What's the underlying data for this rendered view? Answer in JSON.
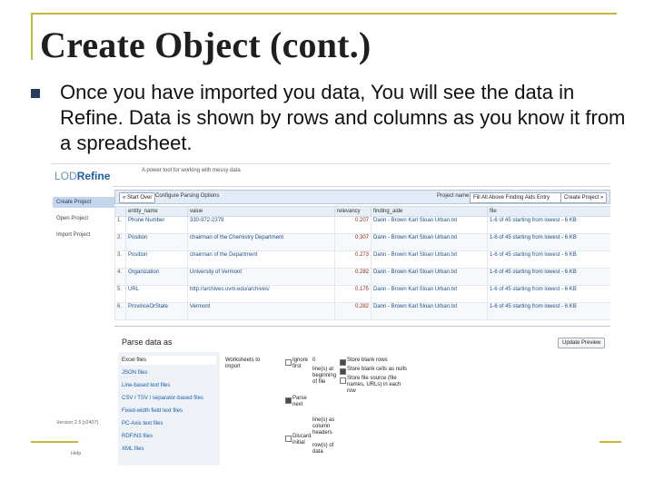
{
  "slide": {
    "title": "Create Object (cont.)",
    "bullet": "Once you have imported you data, You will see the data in Refine. Data is shown by rows and columns as you know it from a spreadsheet."
  },
  "app": {
    "logo_prefix": "LOD",
    "logo_name": "Refine",
    "tagline": "A power tool for working with messy data",
    "sidebar": {
      "items": [
        "Create Project",
        "Open Project",
        "Import Project"
      ],
      "version": "Version 2.5 [r2407]",
      "help": "Help"
    },
    "toolbar": {
      "start_over": "« Start Over",
      "configure": "Configure Parsing Options",
      "project_name_label": "Project name",
      "project_name_value": "Fill All Above Finding Aids Entry",
      "create_project": "Create Project »"
    },
    "table": {
      "columns": [
        "",
        "entity_name",
        "value",
        "relevancy",
        "finding_aide",
        "file"
      ],
      "rows": [
        {
          "n": "1.",
          "entity": "Phone Number",
          "value": "330-972-2379",
          "rel": "0.207",
          "aide": "Dann - Brown Karl Sloan Urban.txt",
          "file": "1-6 of 45 starting from lowest - 6 KB"
        },
        {
          "n": "2.",
          "entity": "Position",
          "value": "chairman of the Chemistry Department",
          "rel": "0.307",
          "aide": "Dann - Brown Karl Sloan Urban.txt",
          "file": "1-6 of 45 starting from lowest - 6 KB"
        },
        {
          "n": "3.",
          "entity": "Position",
          "value": "chairman of the Department",
          "rel": "0.273",
          "aide": "Dann - Brown Karl Sloan Urban.txt",
          "file": "1-6 of 45 starting from lowest - 6 KB"
        },
        {
          "n": "4.",
          "entity": "Organization",
          "value": "University of Vermont",
          "rel": "0.282",
          "aide": "Dann - Brown Karl Sloan Urban.txt",
          "file": "1-6 of 45 starting from lowest - 6 KB"
        },
        {
          "n": "5.",
          "entity": "URL",
          "value": "http://archives.uvm.edu/archives/",
          "rel": "0.175",
          "aide": "Dann - Brown Karl Sloan Urban.txt",
          "file": "1-6 of 45 starting from lowest - 6 KB"
        },
        {
          "n": "6.",
          "entity": "ProvinceOrState",
          "value": "Vermont",
          "rel": "0.282",
          "aide": "Dann - Brown Karl Sloan Urban.txt",
          "file": "1-6 of 45 starting from lowest - 6 KB"
        }
      ]
    },
    "parse": {
      "title": "Parse data as",
      "update_preview": "Update Preview",
      "formats": [
        "Excel files",
        "JSON files",
        "Line-based text files",
        "CSV / TSV / separator-based files",
        "Fixed-width field text files",
        "PC-Axis text files",
        "RDF/N3 files",
        "XML files"
      ],
      "options": {
        "worksheets": "Worksheets to import",
        "ignore": "Ignore first",
        "lines": "line(s) at beginning of file",
        "parse_next": "Parse next",
        "headers": "line(s) as column headers",
        "discard": "Discard initial",
        "rows": "row(s) of data",
        "store_blank_rows": "Store blank rows",
        "store_blank_cells": "Store blank cells as nulls",
        "store_source": "Store file source (file names, URLs) in each row",
        "zero": "0"
      }
    }
  }
}
